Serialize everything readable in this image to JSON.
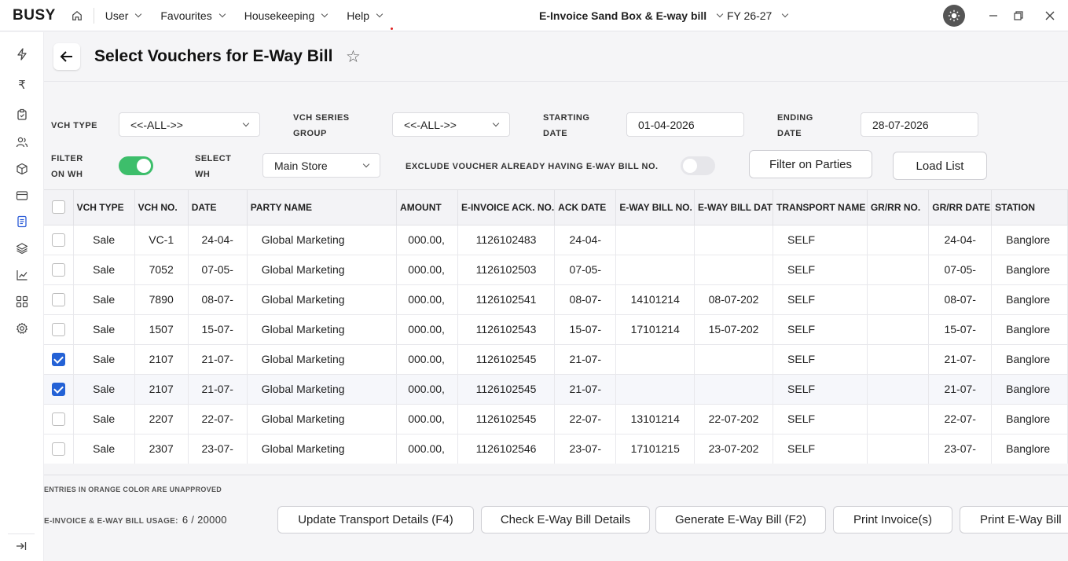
{
  "app": {
    "logo": "BUSY",
    "menu": [
      {
        "label": "User"
      },
      {
        "label": "Favourites"
      },
      {
        "label": "Housekeeping"
      },
      {
        "label": "Help"
      }
    ],
    "company": "E-Invoice Sand Box & E-way bill",
    "fy": "FY 26-27"
  },
  "sidebar": {
    "icons": [
      "lightning-icon",
      "rupee-icon",
      "clipboard-icon",
      "users-icon",
      "box-icon",
      "card-icon",
      "document-icon",
      "layers-icon",
      "chart-icon",
      "grid-icon",
      "gear-icon"
    ],
    "active": "document-icon"
  },
  "page": {
    "title": "Select Vouchers for E-Way Bill"
  },
  "filters": {
    "vch_type_label": "VCH TYPE",
    "vch_type_value": "<<-ALL->>",
    "vch_series_label_1": "VCH SERIES",
    "vch_series_label_2": "GROUP",
    "vch_series_value": "<<-ALL->>",
    "starting_label_1": "STARTING",
    "starting_label_2": "DATE",
    "starting_value": "01-04-2026",
    "ending_label_1": "ENDING",
    "ending_label_2": "DATE",
    "ending_value": "28-07-2026",
    "filter_wh_label_1": "FILTER",
    "filter_wh_label_2": "ON WH",
    "filter_wh_on": true,
    "select_wh_label_1": "SELECT",
    "select_wh_label_2": "WH",
    "select_wh_value": "Main Store",
    "exclude_label": "EXCLUDE VOUCHER ALREADY HAVING E-WAY BILL NO.",
    "exclude_on": false,
    "filter_parties_button": "Filter on Parties",
    "load_list_button": "Load List"
  },
  "table": {
    "columns": [
      "VCH TYPE",
      "VCH NO.",
      "DATE",
      "PARTY NAME",
      "AMOUNT",
      "E-INVOICE ACK. NO.",
      "ACK DATE",
      "E-WAY BILL NO.",
      "E-WAY BILL DAT",
      "TRANSPORT NAME",
      "GR/RR NO.",
      "GR/RR DATE",
      "STATION"
    ],
    "rows": [
      {
        "checked": false,
        "cells": [
          "Sale",
          "VC-1",
          "24-04-",
          "Global Marketing",
          ",000.00",
          "1126102483",
          "24-04-",
          "",
          "",
          "SELF",
          "",
          "24-04-",
          "Banglore"
        ]
      },
      {
        "checked": false,
        "cells": [
          "Sale",
          "7052",
          "07-05-",
          "Global Marketing",
          ",000.00",
          "1126102503",
          "07-05-",
          "",
          "",
          "SELF",
          "",
          "07-05-",
          "Banglore"
        ]
      },
      {
        "checked": false,
        "cells": [
          "Sale",
          "7890",
          "08-07-",
          "Global Marketing",
          ",000.00",
          "1126102541",
          "08-07-",
          "14101214",
          "08-07-202",
          "SELF",
          "",
          "08-07-",
          "Banglore"
        ]
      },
      {
        "checked": false,
        "cells": [
          "Sale",
          "1507",
          "15-07-",
          "Global Marketing",
          ",000.00",
          "1126102543",
          "15-07-",
          "17101214",
          "15-07-202",
          "SELF",
          "",
          "15-07-",
          "Banglore"
        ]
      },
      {
        "checked": true,
        "cells": [
          "Sale",
          "2107",
          "21-07-",
          "Global Marketing",
          ",000.00",
          "1126102545",
          "21-07-",
          "",
          "",
          "SELF",
          "",
          "21-07-",
          "Banglore"
        ]
      },
      {
        "checked": true,
        "cells": [
          "Sale",
          "2107",
          "21-07-",
          "Global Marketing",
          ",000.00",
          "1126102545",
          "21-07-",
          "",
          "",
          "SELF",
          "",
          "21-07-",
          "Banglore"
        ]
      },
      {
        "checked": false,
        "cells": [
          "Sale",
          "2207",
          "22-07-",
          "Global Marketing",
          ",000.00",
          "1126102545",
          "22-07-",
          "13101214",
          "22-07-202",
          "SELF",
          "",
          "22-07-",
          "Banglore"
        ]
      },
      {
        "checked": false,
        "cells": [
          "Sale",
          "2307",
          "23-07-",
          "Global Marketing",
          ",000.00",
          "1126102546",
          "23-07-",
          "17101215",
          "23-07-202",
          "SELF",
          "",
          "23-07-",
          "Banglore"
        ]
      }
    ]
  },
  "footer": {
    "note": "ENTRIES IN ORANGE COLOR ARE UNAPPROVED",
    "usage_label": "E-INVOICE & E-WAY BILL USAGE:",
    "usage_value": "6 / 20000",
    "buttons": {
      "update_transport": "Update Transport Details (F4)",
      "check_eway": "Check E-Way Bill Details",
      "generate_eway": "Generate E-Way Bill (F2)",
      "print_invoice": "Print Invoice(s)",
      "print_eway": "Print E-Way Bill"
    }
  },
  "colors": {
    "accent": "#2462d6",
    "toggle_on": "#3dbe6b",
    "toggle_off": "#e6e6ea"
  }
}
